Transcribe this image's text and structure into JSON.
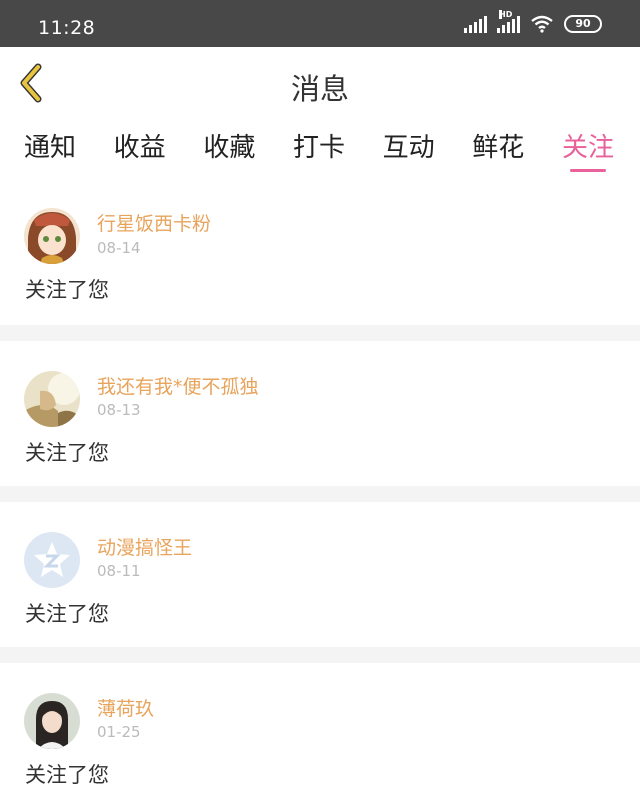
{
  "status": {
    "time": "11:28",
    "battery": "90",
    "hd_label": "HD"
  },
  "header": {
    "title": "消息"
  },
  "tabs": [
    {
      "label": "通知"
    },
    {
      "label": "收益"
    },
    {
      "label": "收藏"
    },
    {
      "label": "打卡"
    },
    {
      "label": "互动"
    },
    {
      "label": "鲜花"
    },
    {
      "label": "关注"
    }
  ],
  "active_tab": "关注",
  "colors": {
    "accent": "#e8619a",
    "username": "#e8a45c",
    "back_arrow": "#e8c440"
  },
  "messages": [
    {
      "name": "行星饭西卡粉",
      "date": "08-14",
      "content": "关注了您",
      "avatar_icon": "anime-girl-avatar"
    },
    {
      "name": "我还有我*便不孤独",
      "date": "08-13",
      "content": "关注了您",
      "avatar_icon": "photo-avatar"
    },
    {
      "name": "动漫搞怪王",
      "date": "08-11",
      "content": "关注了您",
      "avatar_icon": "default-star-avatar"
    },
    {
      "name": "薄荷玖",
      "date": "01-25",
      "content": "关注了您",
      "avatar_icon": "girl-photo-avatar"
    }
  ]
}
